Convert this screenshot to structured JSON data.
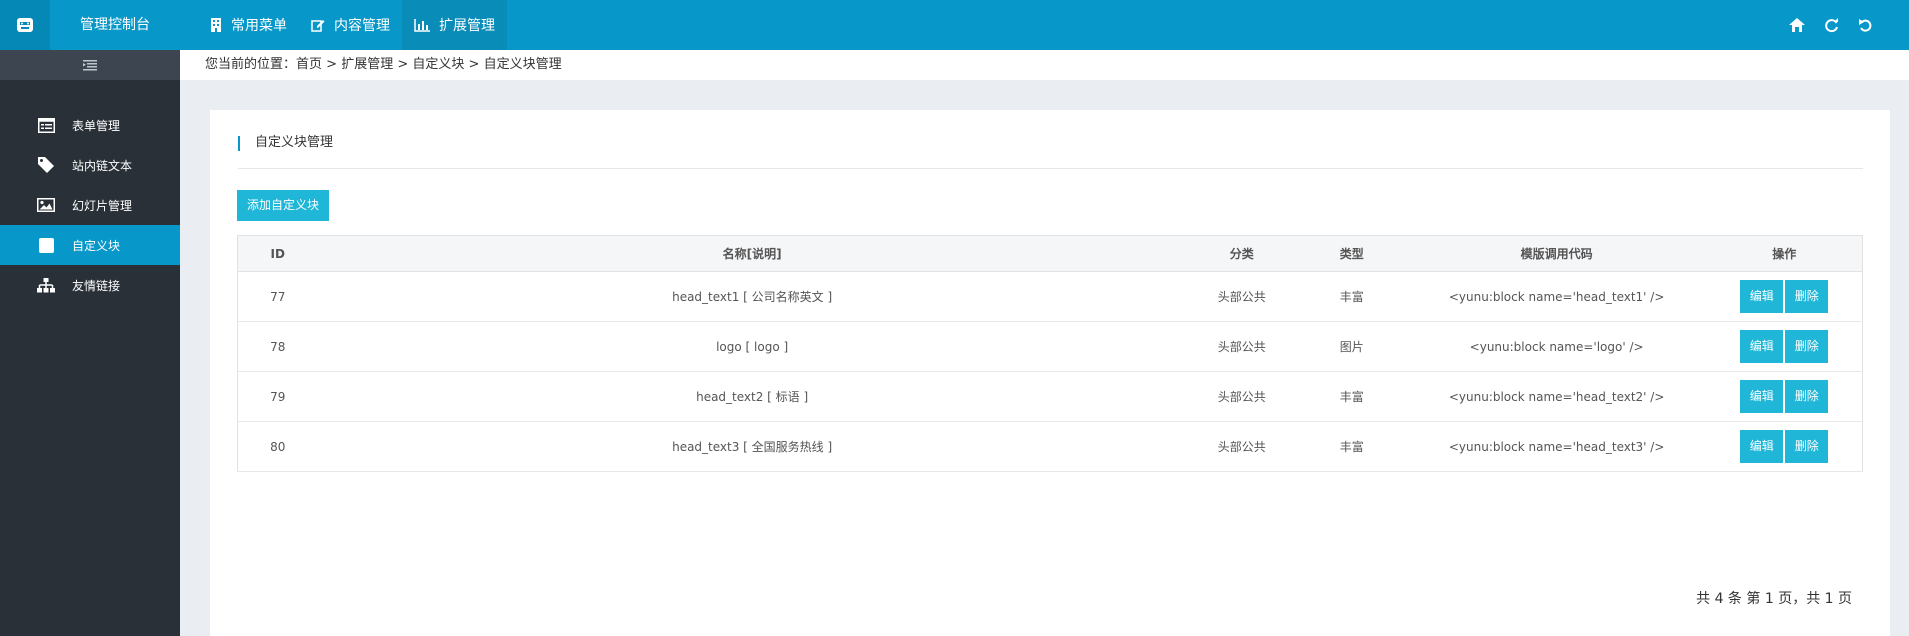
{
  "header": {
    "app_title": "管理控制台",
    "nav": [
      {
        "label": "常用菜单",
        "icon": "building-icon"
      },
      {
        "label": "内容管理",
        "icon": "edit-icon"
      },
      {
        "label": "扩展管理",
        "icon": "bar-chart-icon"
      }
    ],
    "right_icons": [
      "home-icon",
      "refresh-icon",
      "undo-icon"
    ]
  },
  "sidebar": {
    "items": [
      {
        "label": "表单管理",
        "icon": "form-icon"
      },
      {
        "label": "站内链文本",
        "icon": "tag-icon"
      },
      {
        "label": "幻灯片管理",
        "icon": "image-icon"
      },
      {
        "label": "自定义块",
        "icon": "square-icon"
      },
      {
        "label": "友情链接",
        "icon": "sitemap-icon"
      }
    ],
    "active_index": 3
  },
  "breadcrumb": {
    "prefix": "您当前的位置：",
    "items": [
      "首页",
      "扩展管理",
      "自定义块",
      "自定义块管理"
    ],
    "sep": " > "
  },
  "card": {
    "title": "自定义块管理",
    "add_button": "添加自定义块"
  },
  "table": {
    "headers": [
      "ID",
      "名称[说明]",
      "分类",
      "类型",
      "模版调用代码",
      "操作"
    ],
    "rows": [
      {
        "id": "77",
        "name": "head_text1 [ 公司名称英文 ]",
        "category": "头部公共",
        "type": "丰富",
        "code": "<yunu:block name='head_text1' />"
      },
      {
        "id": "78",
        "name": "logo [ logo ]",
        "category": "头部公共",
        "type": "图片",
        "code": "<yunu:block name='logo' />"
      },
      {
        "id": "79",
        "name": "head_text2 [ 标语 ]",
        "category": "头部公共",
        "type": "丰富",
        "code": "<yunu:block name='head_text2' />"
      },
      {
        "id": "80",
        "name": "head_text3 [ 全国服务热线 ]",
        "category": "头部公共",
        "type": "丰富",
        "code": "<yunu:block name='head_text3' />"
      }
    ],
    "edit_label": "编辑",
    "delete_label": "删除"
  },
  "pager": {
    "text": "共 4 条 第 1 页，共 1 页"
  },
  "colors": {
    "primary": "#0798c9",
    "button": "#1fb6d8",
    "sidebar": "#293038"
  }
}
